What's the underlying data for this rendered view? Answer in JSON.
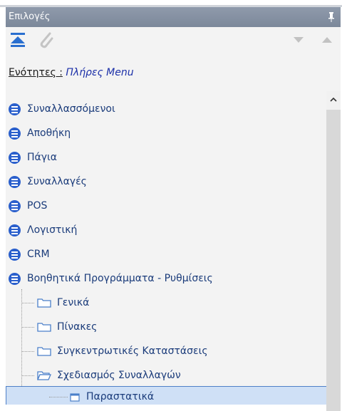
{
  "panel": {
    "title": "Επιλογές"
  },
  "section": {
    "label": "Ενότητες :",
    "value": "Πλήρες Menu"
  },
  "tree": {
    "items": [
      {
        "label": "Συναλλασσόμενοι"
      },
      {
        "label": "Αποθήκη"
      },
      {
        "label": "Πάγια"
      },
      {
        "label": "Συναλλαγές"
      },
      {
        "label": "POS"
      },
      {
        "label": "Λογιστική"
      },
      {
        "label": "CRM"
      },
      {
        "label": "Βοηθητικά Προγράμματα - Ρυθμίσεις"
      }
    ],
    "children": [
      {
        "label": "Γενικά"
      },
      {
        "label": "Πίνακες"
      },
      {
        "label": "Συγκεντρωτικές Καταστάσεις"
      },
      {
        "label": "Σχεδιασμός Συναλλαγών"
      }
    ],
    "selected": {
      "label": "Παραστατικά"
    }
  },
  "colors": {
    "accent": "#2a5fcc",
    "title_bar": "#8591a3",
    "selection": "#cfe0f6"
  },
  "icons": [
    "pin-icon",
    "collapse-all-icon",
    "attach-icon",
    "move-down-icon",
    "move-up-icon",
    "menu-bullet-icon",
    "folder-icon",
    "scroll-up-icon"
  ]
}
